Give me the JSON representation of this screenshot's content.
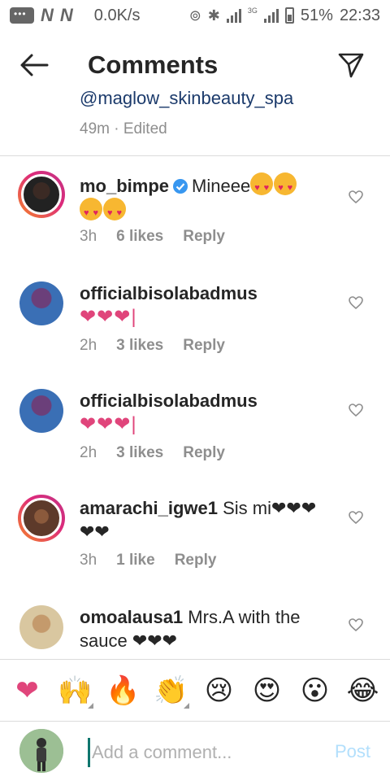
{
  "status_bar": {
    "net_speed": "0.0K/s",
    "battery_percent": "51%",
    "time": "22:33",
    "network_badge": "3G",
    "n_label": "N"
  },
  "header": {
    "title": "Comments"
  },
  "caption": {
    "mention": "@maglow_skinbeauty_spa",
    "meta": "49m · Edited"
  },
  "comments": [
    {
      "username": "mo_bimpe",
      "verified": true,
      "text": "Mineee",
      "time": "3h",
      "likes": "6 likes",
      "reply": "Reply"
    },
    {
      "username": "officialbisolabadmus",
      "verified": false,
      "text": "❤❤❤|",
      "time": "2h",
      "likes": "3 likes",
      "reply": "Reply"
    },
    {
      "username": "officialbisolabadmus",
      "verified": false,
      "text": "❤❤❤|",
      "time": "2h",
      "likes": "3 likes",
      "reply": "Reply"
    },
    {
      "username": "amarachi_igwe1",
      "verified": false,
      "text": "Sis mi❤❤❤❤❤",
      "time": "3h",
      "likes": "1 like",
      "reply": "Reply"
    },
    {
      "username": "omoalausa1",
      "verified": false,
      "text": "Mrs.A with the sauce ❤❤❤",
      "time": "",
      "likes": "",
      "reply": ""
    }
  ],
  "emoji_bar": [
    "❤",
    "🙌",
    "🔥",
    "👏",
    "😢",
    "😍",
    "😮",
    "😂"
  ],
  "input": {
    "placeholder": "Add a comment...",
    "post_label": "Post"
  },
  "colors": {
    "heart": "#e0457b",
    "link": "#1b3a6b",
    "muted": "#8e8e8e",
    "post_disabled": "#b2dffc",
    "verified": "#3897f0"
  }
}
